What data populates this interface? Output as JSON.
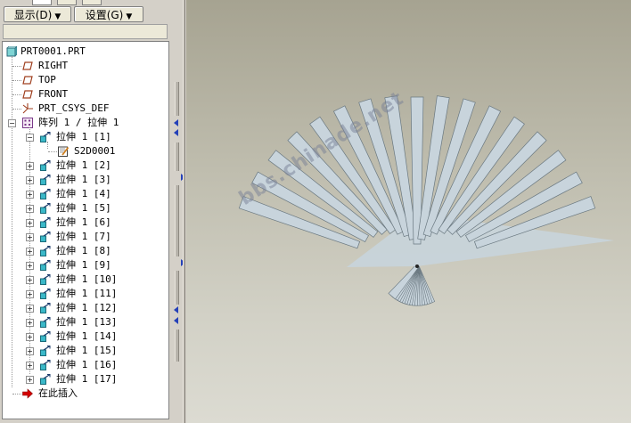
{
  "toolbar": {
    "show_label": "显示(D)",
    "settings_label": "设置(G)"
  },
  "tree": {
    "root": "PRT0001.PRT",
    "datums": [
      "RIGHT",
      "TOP",
      "FRONT"
    ],
    "csys": "PRT_CSYS_DEF",
    "pattern": "阵列 1 / 拉伸 1",
    "members": [
      "拉伸 1 [1]",
      "拉伸 1 [2]",
      "拉伸 1 [3]",
      "拉伸 1 [4]",
      "拉伸 1 [5]",
      "拉伸 1 [6]",
      "拉伸 1 [7]",
      "拉伸 1 [8]",
      "拉伸 1 [9]",
      "拉伸 1 [10]",
      "拉伸 1 [11]",
      "拉伸 1 [12]",
      "拉伸 1 [13]",
      "拉伸 1 [14]",
      "拉伸 1 [15]",
      "拉伸 1 [16]",
      "拉伸 1 [17]"
    ],
    "sketch": "S2D0001",
    "insert_here": "在此插入"
  },
  "viewport": {
    "watermark": "bbs.chinade.net",
    "model": {
      "blade_count": 17,
      "fan_span_deg": 140,
      "colors": {
        "blade_fill": "#c8d4dc",
        "blade_stroke": "#6a7880",
        "background_top": "#a6a391",
        "background_bottom": "#dcdbd2"
      }
    }
  },
  "colors": {
    "tree_bg": "#ffffff",
    "panel_bg": "#d4d0c8",
    "insert_arrow": "#d40000",
    "splitter_arrow": "#2440b8"
  }
}
